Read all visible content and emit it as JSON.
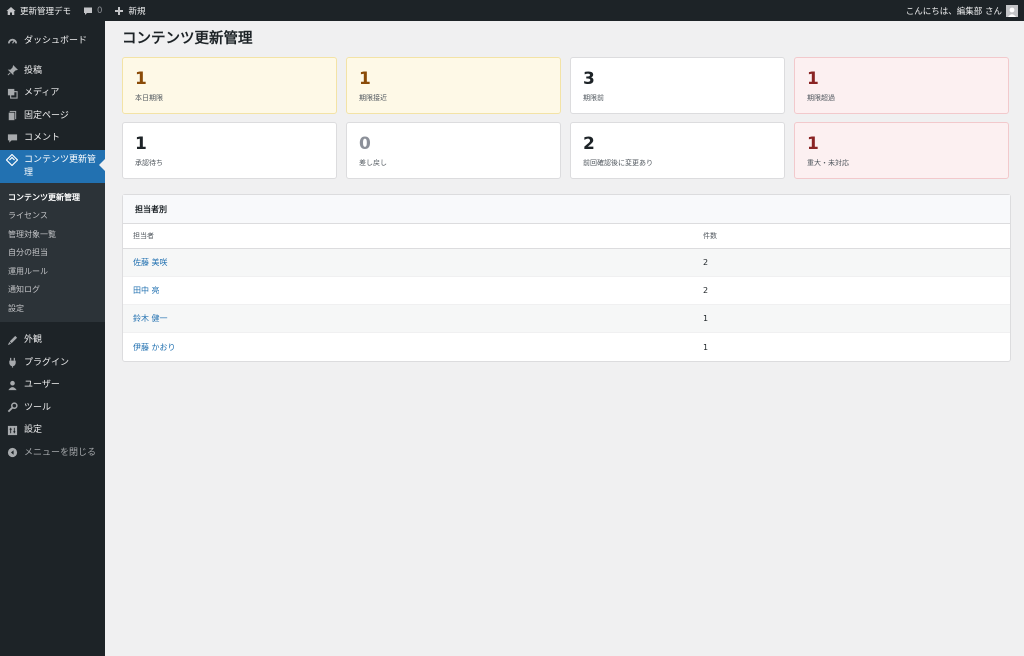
{
  "adminbar": {
    "site_name": "更新管理デモ",
    "comments_count": "0",
    "new_label": "新規",
    "greeting": "こんにちは、編集部 さん",
    "icons": {
      "home": "home-icon",
      "comment": "comment-icon",
      "plus": "plus-icon",
      "avatar": "avatar-icon"
    }
  },
  "sidebar": {
    "items_top": [
      {
        "label": "ダッシュボード",
        "icon": "dashboard-icon"
      }
    ],
    "items_mid": [
      {
        "label": "投稿",
        "icon": "pin-icon"
      },
      {
        "label": "メディア",
        "icon": "media-icon"
      },
      {
        "label": "固定ページ",
        "icon": "page-icon"
      },
      {
        "label": "コメント",
        "icon": "comment-icon"
      }
    ],
    "active": {
      "label": "コンテンツ更新管理",
      "icon": "content-icon"
    },
    "submenu": [
      {
        "label": "コンテンツ更新管理",
        "current": true
      },
      {
        "label": "ライセンス"
      },
      {
        "label": "管理対象一覧"
      },
      {
        "label": "自分の担当"
      },
      {
        "label": "運用ルール"
      },
      {
        "label": "通知ログ"
      },
      {
        "label": "設定"
      }
    ],
    "items_bottom": [
      {
        "label": "外観",
        "icon": "appearance-icon"
      },
      {
        "label": "プラグイン",
        "icon": "plugin-icon"
      },
      {
        "label": "ユーザー",
        "icon": "user-icon"
      },
      {
        "label": "ツール",
        "icon": "tools-icon"
      },
      {
        "label": "設定",
        "icon": "settings-icon"
      }
    ],
    "collapse_label": "メニューを閉じる"
  },
  "main": {
    "title": "コンテンツ更新管理",
    "cards": [
      {
        "value": "1",
        "label": "本日期限",
        "tone": "warn"
      },
      {
        "value": "1",
        "label": "期限接近",
        "tone": "warn"
      },
      {
        "value": "3",
        "label": "期限前",
        "tone": "normal"
      },
      {
        "value": "1",
        "label": "期限超過",
        "tone": "danger"
      },
      {
        "value": "1",
        "label": "承認待ち",
        "tone": "normal"
      },
      {
        "value": "0",
        "label": "差し戻し",
        "tone": "muted"
      },
      {
        "value": "2",
        "label": "前回確認後に変更あり",
        "tone": "normal"
      },
      {
        "value": "1",
        "label": "重大・未対応",
        "tone": "danger"
      }
    ],
    "assignee_panel": {
      "title": "担当者別",
      "columns": [
        "担当者",
        "件数"
      ],
      "rows": [
        {
          "name": "佐藤 美咲",
          "count": "2"
        },
        {
          "name": "田中 亮",
          "count": "2"
        },
        {
          "name": "鈴木 健一",
          "count": "1"
        },
        {
          "name": "伊藤 かおり",
          "count": "1"
        }
      ]
    }
  },
  "colors": {
    "adminbar_bg": "#1d2327",
    "accent": "#2271b1",
    "warn_bg": "#fef9e7",
    "danger_bg": "#fcf0f1"
  }
}
